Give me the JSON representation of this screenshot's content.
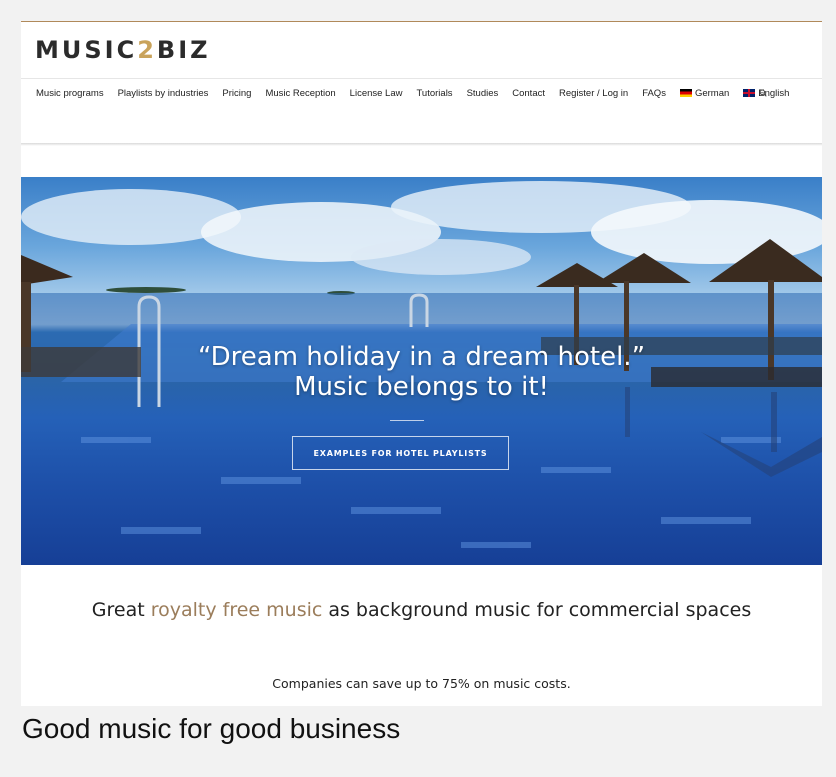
{
  "site": {
    "logo_text_a": "MUSIC",
    "logo_text_b": "2",
    "logo_text_c": "BIZ",
    "accent_color": "#9b7d5b"
  },
  "nav": {
    "items": [
      {
        "label": "Music programs"
      },
      {
        "label": "Playlists by industries"
      },
      {
        "label": "Pricing"
      },
      {
        "label": "Music Reception"
      },
      {
        "label": "License Law"
      },
      {
        "label": "Tutorials"
      },
      {
        "label": "Studies"
      },
      {
        "label": "Contact"
      },
      {
        "label": "Register / Log in"
      },
      {
        "label": "FAQs"
      },
      {
        "label": "German",
        "flag": "de"
      },
      {
        "label": "English",
        "flag": "gb"
      }
    ],
    "search_icon": "search-icon"
  },
  "hero": {
    "quote_line1": "“Dream holiday in a dream hotel.”",
    "quote_line2": "Music belongs to it!",
    "button_label": "EXAMPLES FOR HOTEL PLAYLISTS"
  },
  "content": {
    "headline_before": "Great ",
    "headline_accent": "royalty free music",
    "headline_after": " as background music for commercial spaces",
    "subline": "Companies can save up to 75% on music costs."
  },
  "caption": "Good music for good business"
}
